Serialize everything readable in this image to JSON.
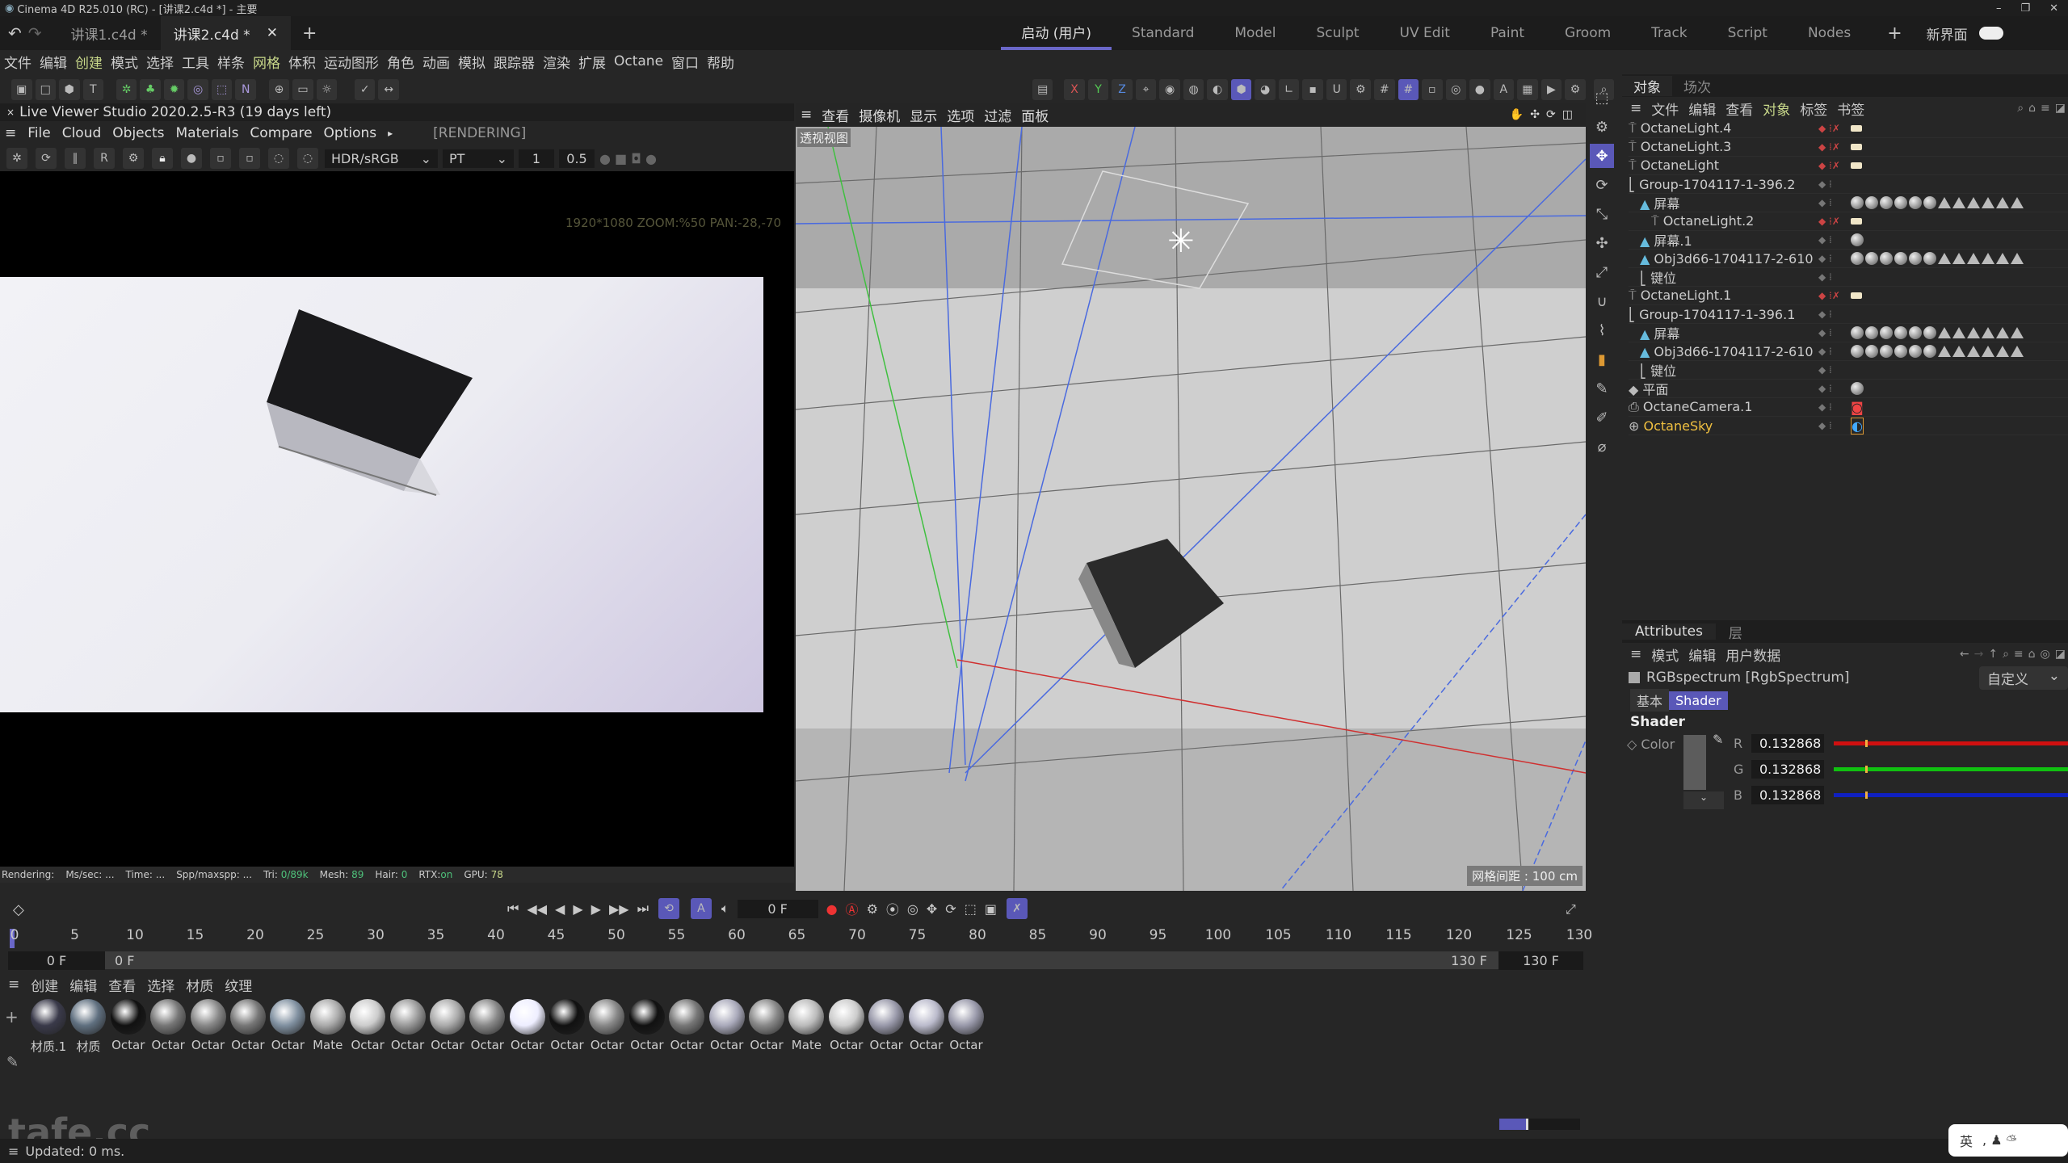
{
  "window": {
    "title": "Cinema 4D R25.010 (RC) - [讲课2.c4d *] - 主要",
    "controls": [
      "–",
      "❐",
      "✕"
    ]
  },
  "doc_tabs": [
    {
      "label": "讲课1.c4d *",
      "active": false
    },
    {
      "label": "讲课2.c4d *",
      "active": true
    }
  ],
  "layout_tabs": [
    {
      "label": "启动 (用户)",
      "active": true
    },
    {
      "label": "Standard"
    },
    {
      "label": "Model"
    },
    {
      "label": "Sculpt"
    },
    {
      "label": "UV Edit"
    },
    {
      "label": "Paint"
    },
    {
      "label": "Groom"
    },
    {
      "label": "Track"
    },
    {
      "label": "Script"
    },
    {
      "label": "Nodes"
    }
  ],
  "new_ui_label": "新界面",
  "main_menu": [
    "文件",
    "编辑",
    "创建",
    "模式",
    "选择",
    "工具",
    "样条",
    "网格",
    "体积",
    "运动图形",
    "角色",
    "动画",
    "模拟",
    "跟踪器",
    "渲染",
    "扩展",
    "Octane",
    "窗口",
    "帮助"
  ],
  "live_viewer": {
    "title": "Live Viewer Studio 2020.2.5-R3 (19 days left)",
    "menu": [
      "File",
      "Cloud",
      "Objects",
      "Materials",
      "Compare",
      "Options"
    ],
    "state": "[RENDERING]",
    "colorspace": "HDR/sRGB",
    "kernel": "PT",
    "value1": "1",
    "value2": "0.5",
    "zoom_info": "1920*1080 ZOOM:%50  PAN:-28,-70",
    "status": {
      "rendering": "Rendering:",
      "mssec": "Ms/sec: ...",
      "time": "Time: ...",
      "spp": "Spp/maxspp: ...",
      "tri_label": "Tri:",
      "tri": "0/89k",
      "mesh_label": "Mesh:",
      "mesh": "89",
      "hair_label": "Hair:",
      "hair": "0",
      "rtx_label": "RTX:",
      "rtx": "on",
      "gpu_label": "GPU:",
      "gpu": "78"
    }
  },
  "viewport": {
    "menu": [
      "查看",
      "摄像机",
      "显示",
      "选项",
      "过滤",
      "面板"
    ],
    "label": "透视视图",
    "grid_info": "网格间距 : 100 cm"
  },
  "object_manager": {
    "tabs": [
      "对象",
      "场次"
    ],
    "menu": [
      "文件",
      "编辑",
      "查看",
      "对象",
      "标签",
      "书签"
    ],
    "objects": [
      {
        "name": "OctaneLight.4",
        "icon": "light",
        "indent": 0,
        "tags": "lamp"
      },
      {
        "name": "OctaneLight.3",
        "icon": "light",
        "indent": 0,
        "tags": "lamp"
      },
      {
        "name": "OctaneLight",
        "icon": "light",
        "indent": 0,
        "tags": "lamp"
      },
      {
        "name": "Group-1704117-1-396.2",
        "icon": "null",
        "indent": 0,
        "tags": ""
      },
      {
        "name": "屏幕",
        "icon": "poly",
        "indent": 1,
        "tags": "mats"
      },
      {
        "name": "OctaneLight.2",
        "icon": "light",
        "indent": 2,
        "tags": "lamp"
      },
      {
        "name": "屏幕.1",
        "icon": "poly",
        "indent": 1,
        "tags": "one"
      },
      {
        "name": "Obj3d66-1704117-2-610",
        "icon": "poly",
        "indent": 1,
        "tags": "mats"
      },
      {
        "name": "键位",
        "icon": "null",
        "indent": 1,
        "tags": ""
      },
      {
        "name": "OctaneLight.1",
        "icon": "light",
        "indent": 0,
        "tags": "lamp"
      },
      {
        "name": "Group-1704117-1-396.1",
        "icon": "null",
        "indent": 0,
        "tags": ""
      },
      {
        "name": "屏幕",
        "icon": "poly",
        "indent": 1,
        "tags": "mats"
      },
      {
        "name": "Obj3d66-1704117-2-610",
        "icon": "poly",
        "indent": 1,
        "tags": "mats"
      },
      {
        "name": "键位",
        "icon": "null",
        "indent": 1,
        "tags": ""
      },
      {
        "name": "平面",
        "icon": "plane",
        "indent": 0,
        "tags": "one"
      },
      {
        "name": "OctaneCamera.1",
        "icon": "camera",
        "indent": 0,
        "tags": "cam"
      },
      {
        "name": "OctaneSky",
        "icon": "sky",
        "indent": 0,
        "tags": "sky",
        "highlight": true
      }
    ]
  },
  "attributes": {
    "tabs": [
      "Attributes",
      "层"
    ],
    "menu": [
      "模式",
      "编辑",
      "用户数据"
    ],
    "object": "RGBspectrum [RgbSpectrum]",
    "preset": "自定义",
    "subtabs": [
      {
        "label": "基本"
      },
      {
        "label": "Shader",
        "active": true
      }
    ],
    "section": "Shader",
    "color_label": "Color",
    "channels": [
      {
        "label": "R",
        "value": "0.132868",
        "color": "#d01010"
      },
      {
        "label": "G",
        "value": "0.132868",
        "color": "#10c010"
      },
      {
        "label": "B",
        "value": "0.132868",
        "color": "#1020c0"
      }
    ],
    "channel_fraction": 0.132868
  },
  "timeline": {
    "current_frame": "0 F",
    "start": "0 F",
    "start_field": "0 F",
    "end": "130 F",
    "end_field": "130 F",
    "ticks": [
      "0",
      "5",
      "10",
      "15",
      "20",
      "25",
      "30",
      "35",
      "40",
      "45",
      "50",
      "55",
      "60",
      "65",
      "70",
      "75",
      "80",
      "85",
      "90",
      "95",
      "100",
      "105",
      "110",
      "115",
      "120",
      "125",
      "130"
    ]
  },
  "material_manager": {
    "menu": [
      "创建",
      "编辑",
      "查看",
      "选择",
      "材质",
      "纹理"
    ],
    "materials": [
      "材质.1",
      "材质",
      "Octar",
      "Octar",
      "Octar",
      "Octar",
      "Octar",
      "Mate",
      "Octar",
      "Octar",
      "Octar",
      "Octar",
      "Octar",
      "Octar",
      "Octar",
      "Octar",
      "Octar",
      "Octar",
      "Octar",
      "Mate",
      "Octar",
      "Octar",
      "Octar",
      "Octar"
    ]
  },
  "status_bar": "Updated: 0 ms.",
  "ime": "英",
  "watermark": "tafe.cc",
  "colors": {
    "accent": "#5a58b8",
    "highlight_text": "#c8d88a",
    "sky": "#f0c040"
  }
}
